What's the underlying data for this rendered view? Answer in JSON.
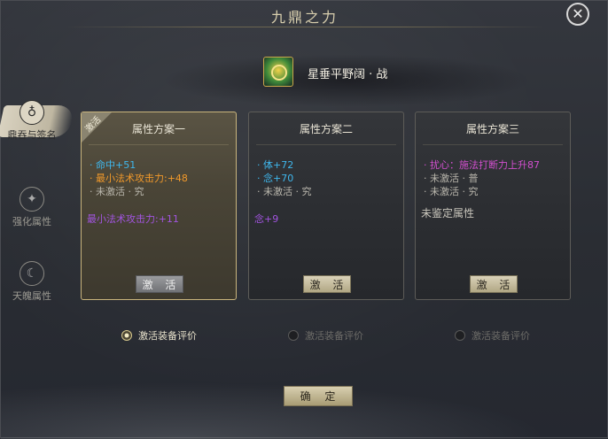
{
  "window": {
    "title": "九鼎之力",
    "close_icon": "close-icon"
  },
  "sidebar": {
    "items": [
      {
        "label": "鼎吞与签名",
        "icon": "ding-icon",
        "active": true
      },
      {
        "label": "强化属性",
        "icon": "star-emblem-icon",
        "active": false
      },
      {
        "label": "天魄属性",
        "icon": "moon-emblem-icon",
        "active": false
      }
    ]
  },
  "item": {
    "name": "星垂平野阔 · 战",
    "icon": "equipment-icon"
  },
  "cards": [
    {
      "title": "属性方案一",
      "badge": "激活",
      "button": "激 活",
      "lines": [
        {
          "text": "· 命中+51",
          "color": "#3fb8ee"
        },
        {
          "text": "· 最小法术攻击力:+48",
          "color": "#f39a2a"
        },
        {
          "text": "· 未激活 · 究",
          "color": "#b9b6ac"
        }
      ],
      "bonus": {
        "text": "最小法术攻击力:+11",
        "color": "#a254e0"
      }
    },
    {
      "title": "属性方案二",
      "button": "激 活",
      "lines": [
        {
          "text": "· 体+72",
          "color": "#3fb8ee"
        },
        {
          "text": "· 念+70",
          "color": "#3fb8ee"
        },
        {
          "text": "· 未激活 · 究",
          "color": "#b9b6ac"
        }
      ],
      "bonus": {
        "text": "念+9",
        "color": "#a254e0"
      }
    },
    {
      "title": "属性方案三",
      "button": "激 活",
      "lines": [
        {
          "text": "· 扰心：施法打断力上升87",
          "color": "#d24fcf"
        },
        {
          "text": "· 未激活 · 普",
          "color": "#b9b6ac"
        },
        {
          "text": "· 未激活 · 究",
          "color": "#b9b6ac"
        }
      ],
      "bonus": {
        "text": "未鉴定属性",
        "color": "#c9c6bc"
      }
    }
  ],
  "radios": [
    {
      "label": "激活装备评价",
      "checked": true
    },
    {
      "label": "激活装备评价",
      "checked": false
    },
    {
      "label": "激活装备评价",
      "checked": false
    }
  ],
  "confirm_label": "确 定"
}
